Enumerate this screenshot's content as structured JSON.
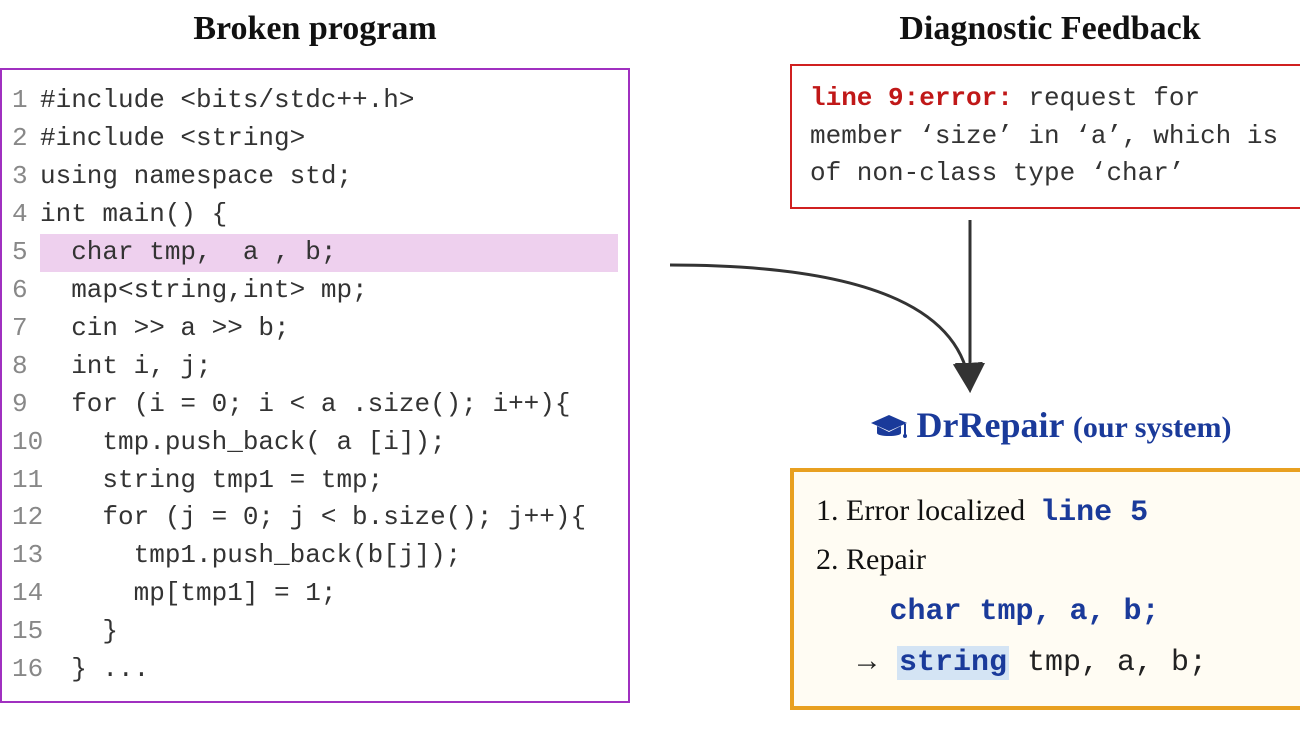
{
  "left": {
    "title": "Broken program",
    "code": {
      "lines": [
        {
          "n": "1",
          "t": "#include <bits/stdc++.h>"
        },
        {
          "n": "2",
          "t": "#include <string>"
        },
        {
          "n": "3",
          "t": "using namespace std;"
        },
        {
          "n": "4",
          "t": "int main() {"
        },
        {
          "n": "5",
          "t": "  char tmp,  a , b;",
          "hl": true
        },
        {
          "n": "6",
          "t": "  map<string,int> mp;"
        },
        {
          "n": "7",
          "t": "  cin >> a >> b;"
        },
        {
          "n": "8",
          "t": "  int i, j;"
        },
        {
          "n": "9",
          "t": "  for (i = 0; i < a .size(); i++){"
        },
        {
          "n": "10",
          "t": "    tmp.push_back( a [i]);"
        },
        {
          "n": "11",
          "t": "    string tmp1 = tmp;"
        },
        {
          "n": "12",
          "t": "    for (j = 0; j < b.size(); j++){"
        },
        {
          "n": "13",
          "t": "      tmp1.push_back(b[j]);"
        },
        {
          "n": "14",
          "t": "      mp[tmp1] = 1;"
        },
        {
          "n": "15",
          "t": "    }"
        },
        {
          "n": "16",
          "t": "  } ..."
        }
      ]
    }
  },
  "right": {
    "title": "Diagnostic Feedback",
    "diag": {
      "prefix": "line 9:error:",
      "rest": " request for member ‘size’ in ‘a’, which is of non-class type ‘char’"
    },
    "system": {
      "name": "DrRepair",
      "sub": "(our system)"
    },
    "result": {
      "step1_label": "1. Error localized",
      "step1_value": "line 5",
      "step2_label": "2. Repair",
      "original": "char tmp, a, b;",
      "arrow": "→",
      "fixed_hl": "string",
      "fixed_rest": " tmp, a, b;"
    }
  }
}
